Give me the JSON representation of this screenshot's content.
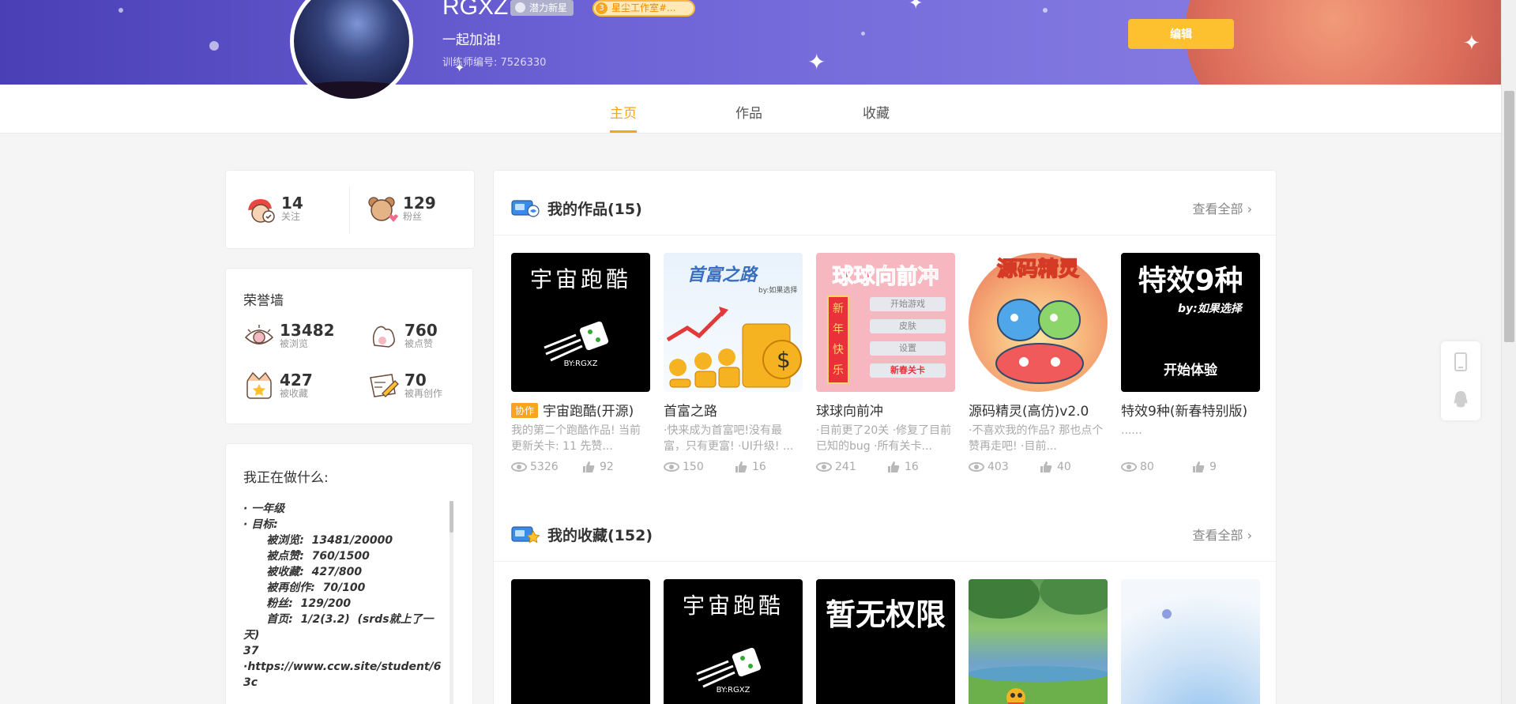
{
  "profile": {
    "username": "RGXZ",
    "badge_rising": "潜力新星",
    "badge_studio": "星尘工作室#...",
    "slogan": "一起加油!",
    "trainer_id": "训练师编号: 7526330",
    "edit_label": "编辑"
  },
  "tabs": [
    {
      "label": "主页",
      "active": true
    },
    {
      "label": "作品",
      "active": false
    },
    {
      "label": "收藏",
      "active": false
    }
  ],
  "follow": {
    "following_count": "14",
    "following_label": "关注",
    "fans_count": "129",
    "fans_label": "粉丝"
  },
  "honor": {
    "title": "荣誉墙",
    "views": "13482",
    "views_label": "被浏览",
    "likes": "760",
    "likes_label": "被点赞",
    "favs": "427",
    "favs_label": "被收藏",
    "remix": "70",
    "remix_label": "被再创作"
  },
  "doing": {
    "title": "我正在做什么:",
    "lines": [
      "· 一年级",
      "· 目标:",
      "      被浏览:  13481/20000",
      "      被点赞:  760/1500",
      "      被收藏:  427/800",
      "      被再创作:  70/100",
      "      粉丝:  129/200",
      "      首页:  1/2(3.2)  (srds就上了一天)",
      "37",
      "·https://www.ccw.site/student/63c"
    ]
  },
  "works_section": {
    "title": "我的作品(15)",
    "view_all": "查看全部",
    "items": [
      {
        "title": "宇宙跑酷(开源)",
        "tag": "协作",
        "desc": "我的第二个跑酷作品! 当前更新关卡: 11 先赞...",
        "views": "5326",
        "likes": "92",
        "thumb_text": "宇宙跑酷",
        "thumb_sub": "BY:RGXZ"
      },
      {
        "title": "首富之路",
        "tag": "",
        "desc": "·快来成为首富吧!没有最富，只有更富! ·UI升级! ...",
        "views": "150",
        "likes": "16",
        "thumb_text": "首富之路",
        "thumb_sub": "by:如果选择"
      },
      {
        "title": "球球向前冲",
        "tag": "",
        "desc": "·目前更了20关 ·修复了目前已知的bug ·所有关卡...",
        "views": "241",
        "likes": "16",
        "thumb_text": "球球向前冲",
        "thumb_sub": "开始游戏"
      },
      {
        "title": "源码精灵(高仿)v2.0",
        "tag": "",
        "desc": "·不喜欢我的作品? 那也点个赞再走吧! ·目前...",
        "views": "403",
        "likes": "40",
        "thumb_text": "源码精灵",
        "thumb_sub": ""
      },
      {
        "title": "特效9种(新春特别版)",
        "tag": "",
        "desc": "......",
        "views": "80",
        "likes": "9",
        "thumb_text": "特效9种",
        "thumb_sub": "by:如果选择"
      }
    ]
  },
  "favs_section": {
    "title": "我的收藏(152)",
    "view_all": "查看全部",
    "items": [
      {
        "thumb_text": "",
        "thumb_sub": ""
      },
      {
        "thumb_text": "宇宙跑酷",
        "thumb_sub": "BY:RGXZ"
      },
      {
        "thumb_text": "暂无权限",
        "thumb_sub": ""
      },
      {
        "thumb_text": "",
        "thumb_sub": ""
      },
      {
        "thumb_text": "",
        "thumb_sub": ""
      }
    ]
  },
  "thumb_extras": {
    "work3_buttons": [
      "开始游戏",
      "皮肤",
      "设置",
      "新春关卡"
    ],
    "work3_vertical": [
      "新",
      "年",
      "快",
      "乐"
    ],
    "work5_start": "开始体验"
  },
  "colors": {
    "accent": "#f7a51e",
    "header_start": "#4a3fb5",
    "edit_button": "#fdc02f"
  }
}
